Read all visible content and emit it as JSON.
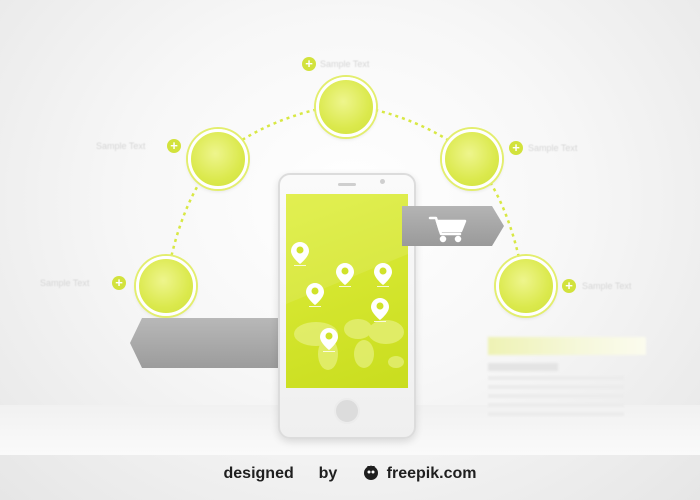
{
  "credit": {
    "designed": "designed",
    "by": "by",
    "brand": "freepik.com"
  },
  "node_labels": [
    "Sample Text",
    "Sample Text",
    "Sample Text",
    "Sample Text",
    "Sample Text"
  ],
  "colors": {
    "accent_green": "#d8e844",
    "screen_green": "#d0e22a",
    "tab_gray": "#a9a9a9"
  },
  "icons": {
    "cart": "shopping-cart-icon",
    "plus": "plus-icon",
    "pin": "location-pin-icon"
  }
}
